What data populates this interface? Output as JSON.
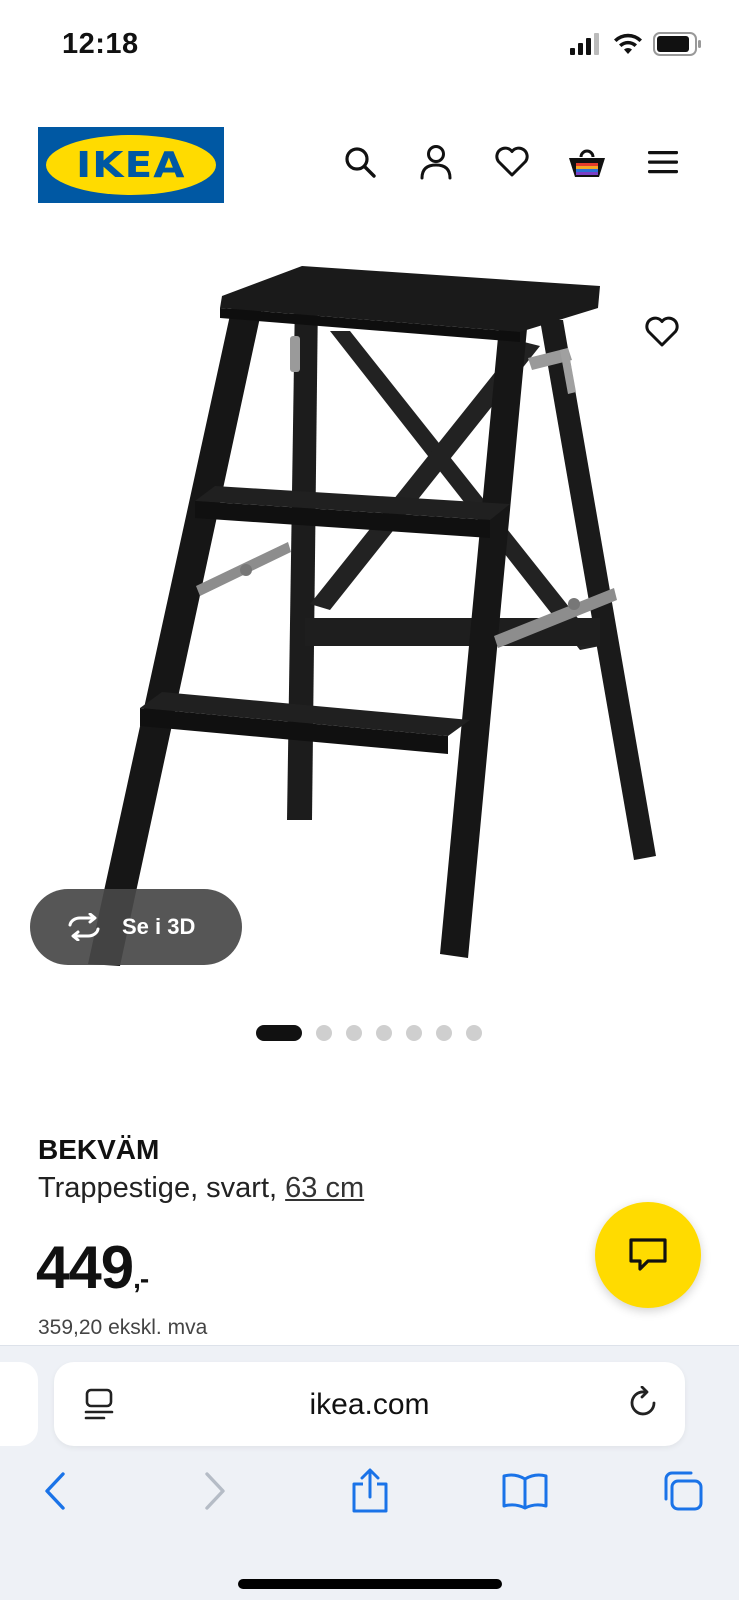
{
  "status_bar": {
    "time": "12:18"
  },
  "header": {
    "logo_text": "IKEA",
    "icons": [
      "search-icon",
      "account-icon",
      "heart-icon",
      "basket-icon",
      "menu-icon"
    ]
  },
  "gallery": {
    "view_3d_label": "Se i 3D",
    "slide_count": 7,
    "active_slide": 1
  },
  "product": {
    "name": "BEKVÄM",
    "description": "Trappestige, svart,",
    "size": "63 cm",
    "price": "449",
    "price_suffix": ",-",
    "price_ex_vat": "359,20 ekskl. mva"
  },
  "browser": {
    "url": "ikea.com"
  },
  "colors": {
    "ikea_blue": "#0058a3",
    "ikea_yellow": "#ffdb00",
    "ios_blue": "#1a73e8"
  }
}
